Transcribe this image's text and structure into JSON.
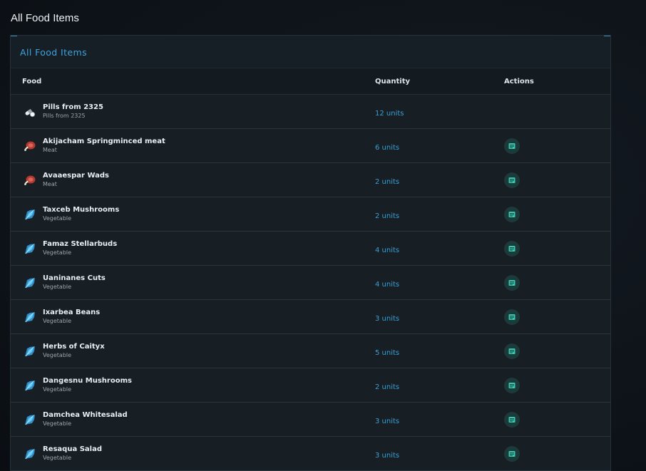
{
  "page": {
    "title": "All Food Items"
  },
  "panel": {
    "title": "All Food Items",
    "columns": {
      "food": "Food",
      "quantity": "Quantity",
      "actions": "Actions"
    }
  },
  "colors": {
    "accent": "#3ea3df",
    "action_icon": "#36c9b0"
  },
  "items": [
    {
      "name": "Pills from 2325",
      "category": "Pills from 2325",
      "quantity": "12 units",
      "icon": "pills-icon",
      "has_action": false
    },
    {
      "name": "Akijacham Springminced meat",
      "category": "Meat",
      "quantity": "6 units",
      "icon": "meat-icon",
      "has_action": true
    },
    {
      "name": "Avaaespar Wads",
      "category": "Meat",
      "quantity": "2 units",
      "icon": "meat-icon",
      "has_action": true
    },
    {
      "name": "Taxceb Mushrooms",
      "category": "Vegetable",
      "quantity": "2 units",
      "icon": "vegetable-icon",
      "has_action": true
    },
    {
      "name": "Famaz Stellarbuds",
      "category": "Vegetable",
      "quantity": "4 units",
      "icon": "vegetable-icon",
      "has_action": true
    },
    {
      "name": "Uaninanes Cuts",
      "category": "Vegetable",
      "quantity": "4 units",
      "icon": "vegetable-icon",
      "has_action": true
    },
    {
      "name": "Ixarbea Beans",
      "category": "Vegetable",
      "quantity": "3 units",
      "icon": "vegetable-icon",
      "has_action": true
    },
    {
      "name": "Herbs of Caityx",
      "category": "Vegetable",
      "quantity": "5 units",
      "icon": "vegetable-icon",
      "has_action": true
    },
    {
      "name": "Dangesnu Mushrooms",
      "category": "Vegetable",
      "quantity": "2 units",
      "icon": "vegetable-icon",
      "has_action": true
    },
    {
      "name": "Damchea Whitesalad",
      "category": "Vegetable",
      "quantity": "3 units",
      "icon": "vegetable-icon",
      "has_action": true
    },
    {
      "name": "Resaqua Salad",
      "category": "Vegetable",
      "quantity": "3 units",
      "icon": "vegetable-icon",
      "has_action": true
    }
  ]
}
